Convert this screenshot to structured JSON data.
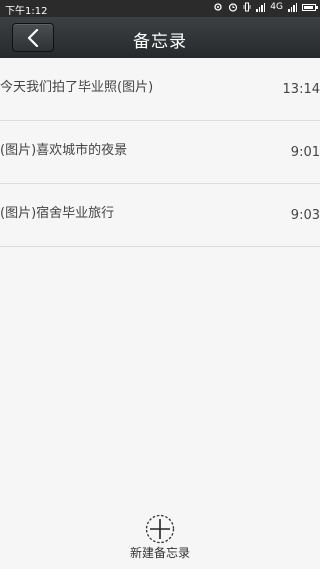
{
  "status_bar": {
    "time": "下午1:12",
    "network": "4G"
  },
  "header": {
    "title": "备忘录",
    "back_icon": "chevron-left-icon"
  },
  "memos": [
    {
      "title": "今天我们拍了毕业照(图片)",
      "time": "13:14"
    },
    {
      "title": "(图片)喜欢城市的夜景",
      "time": "9:01"
    },
    {
      "title": "(图片)宿舍毕业旅行",
      "time": "9:03"
    }
  ],
  "footer": {
    "new_label": "新建备忘录",
    "new_icon": "plus-circle-icon"
  },
  "colors": {
    "status_bar": "#2b2b2b",
    "nav_bar": "#303335",
    "background": "#f6f6f6",
    "divider": "#dcdcdc"
  }
}
